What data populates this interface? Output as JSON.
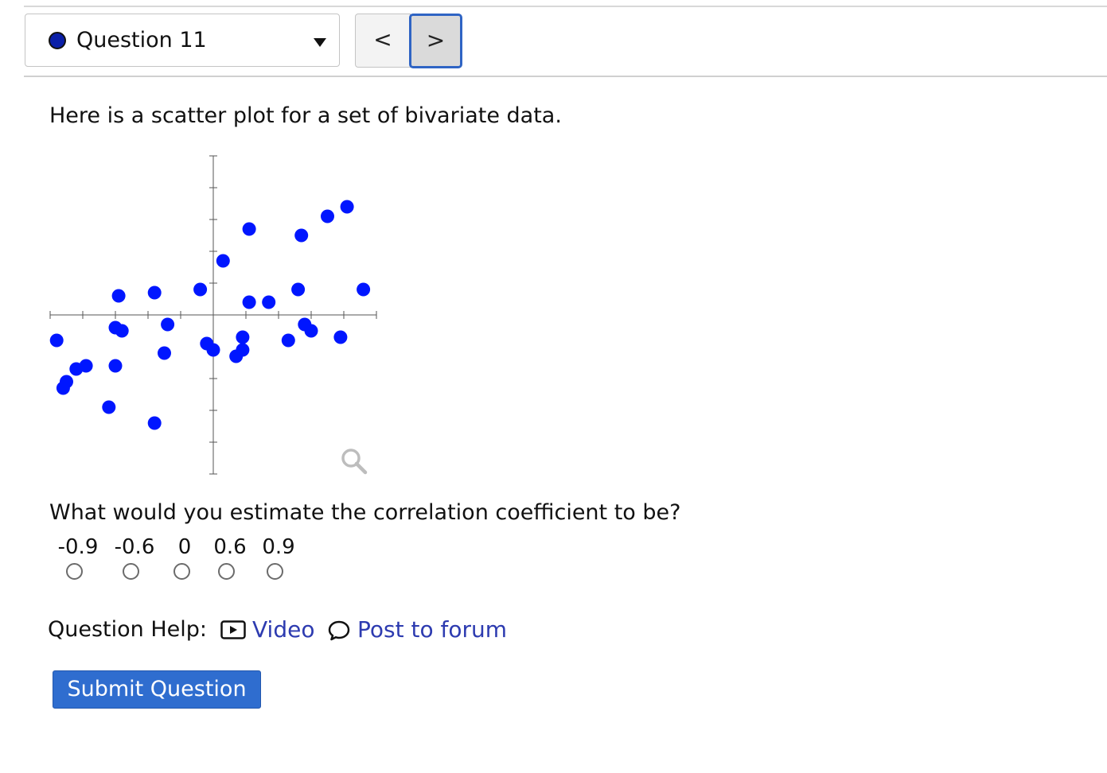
{
  "header": {
    "question_selector_label": "Question 11",
    "prev_symbol": "<",
    "next_symbol": ">"
  },
  "intro_text": "Here is a scatter plot for a set of bivariate data.",
  "prompt_text": "What would you estimate the correlation coefficient to be?",
  "choices": [
    {
      "label": "-0.9",
      "selected": false
    },
    {
      "label": "-0.6",
      "selected": false
    },
    {
      "label": "0",
      "selected": false
    },
    {
      "label": "0.6",
      "selected": false
    },
    {
      "label": "0.9",
      "selected": false
    }
  ],
  "help": {
    "label": "Question Help:",
    "video": "Video",
    "forum": "Post to forum"
  },
  "submit_label": "Submit Question",
  "colors": {
    "accent": "#2f6dcf",
    "link": "#2d3bb0",
    "point": "#0016ff"
  },
  "chart_data": {
    "type": "scatter",
    "title": "",
    "xlabel": "",
    "ylabel": "",
    "xlim": [
      -5.0,
      5.0
    ],
    "ylim": [
      -5.0,
      5.0
    ],
    "grid": false,
    "x": [
      -4.8,
      -4.6,
      -4.5,
      -4.2,
      -3.9,
      -3.2,
      -3.0,
      -3.0,
      -2.9,
      -2.8,
      -1.8,
      -1.8,
      -1.5,
      -1.4,
      -0.4,
      -0.2,
      0.0,
      0.3,
      0.7,
      0.9,
      0.9,
      1.1,
      1.1,
      1.7,
      2.3,
      2.6,
      2.7,
      2.8,
      3.0,
      3.5,
      3.9,
      4.1,
      4.6
    ],
    "y": [
      -0.8,
      -2.3,
      -2.1,
      -1.7,
      -1.6,
      -2.9,
      -1.6,
      -0.4,
      0.6,
      -0.5,
      0.7,
      -3.4,
      -1.2,
      -0.3,
      0.8,
      -0.9,
      -1.1,
      1.7,
      -1.3,
      -0.7,
      -1.1,
      0.4,
      2.7,
      0.4,
      -0.8,
      0.8,
      2.5,
      -0.3,
      -0.5,
      3.1,
      -0.7,
      3.4,
      0.8
    ]
  }
}
